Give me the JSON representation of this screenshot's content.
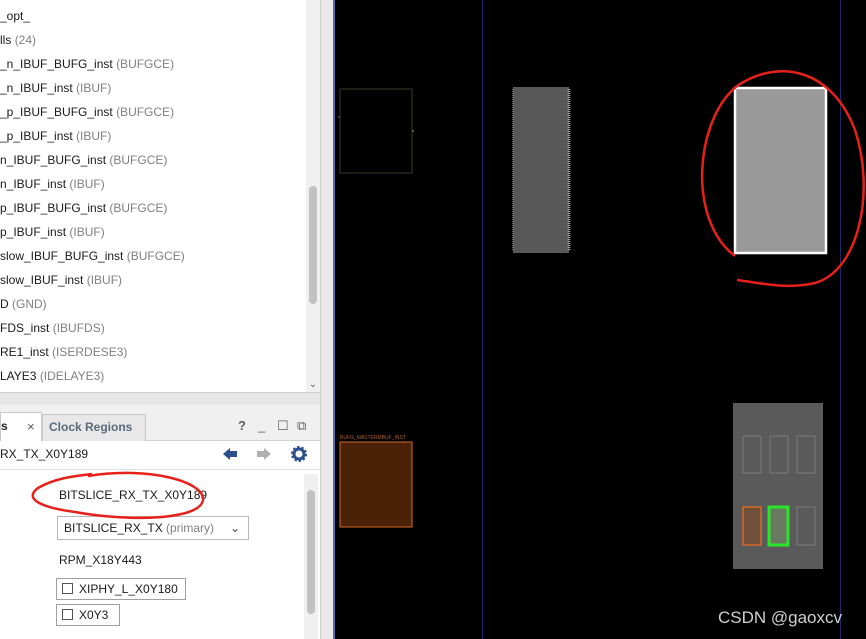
{
  "netlist": {
    "rows": [
      {
        "name": "_opt_",
        "type": ""
      },
      {
        "name": "lls",
        "type": "(24)"
      },
      {
        "name": "_n_IBUF_BUFG_inst",
        "type": "(BUFGCE)"
      },
      {
        "name": "_n_IBUF_inst",
        "type": "(IBUF)"
      },
      {
        "name": "_p_IBUF_BUFG_inst",
        "type": "(BUFGCE)"
      },
      {
        "name": "_p_IBUF_inst",
        "type": "(IBUF)"
      },
      {
        "name": "n_IBUF_BUFG_inst",
        "type": "(BUFGCE)"
      },
      {
        "name": "n_IBUF_inst",
        "type": "(IBUF)"
      },
      {
        "name": "p_IBUF_BUFG_inst",
        "type": "(BUFGCE)"
      },
      {
        "name": "p_IBUF_inst",
        "type": "(IBUF)"
      },
      {
        "name": "slow_IBUF_BUFG_inst",
        "type": "(BUFGCE)"
      },
      {
        "name": "slow_IBUF_inst",
        "type": "(IBUF)"
      },
      {
        "name": "D",
        "type": "(GND)"
      },
      {
        "name": "FDS_inst",
        "type": "(IBUFDS)"
      },
      {
        "name": "RE1_inst",
        "type": "(ISERDESE3)"
      },
      {
        "name": "LAYE3",
        "type": "(IDELAYE3)"
      }
    ]
  },
  "tabs": {
    "active": "s",
    "inactive": "Clock Regions"
  },
  "window_buttons": {
    "help": "?",
    "minimize": "_",
    "maximize": "☐",
    "float": "⧉"
  },
  "props": {
    "header_title": "RX_TX_X0Y189",
    "name_value": "BITSLICE_RX_TX_X0Y189",
    "type_value": "BITSLICE_RX_TX",
    "type_sub": "(primary)",
    "rpm_value": "RPM_X18Y443",
    "tile_link": "XIPHY_L_X0Y180",
    "clock_region_link": "X0Y3"
  },
  "device": {
    "tiny_label": "BUFG_MASTERMBUF_INST"
  },
  "watermark": "CSDN @gaoxcv",
  "colors": {
    "annotation_red": "#e8201a",
    "selected_green": "#29e62a",
    "orange": "#d46a28",
    "brown_cell": "#4b2207"
  }
}
